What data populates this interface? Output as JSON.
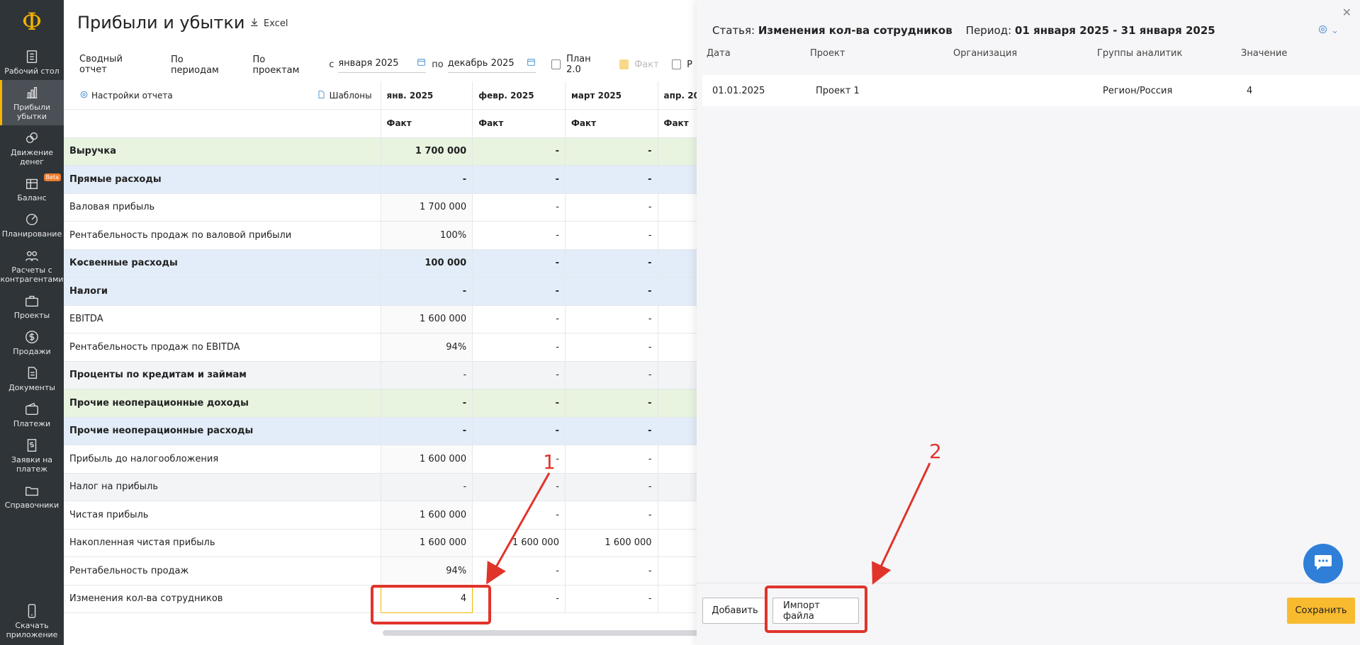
{
  "sidebar": {
    "logo": "Ф",
    "items": [
      {
        "label": "Рабочий стол",
        "icon": "dashboard-icon"
      },
      {
        "label": "Прибыли убытки",
        "icon": "bar-chart-icon",
        "active": true
      },
      {
        "label": "Движение денег",
        "icon": "money-flow-icon"
      },
      {
        "label": "Баланс",
        "icon": "balance-icon",
        "badge": "Beta"
      },
      {
        "label": "Планирование",
        "icon": "planning-icon"
      },
      {
        "label": "Расчеты с контрагентами",
        "icon": "counterparties-icon"
      },
      {
        "label": "Проекты",
        "icon": "briefcase-icon"
      },
      {
        "label": "Продажи",
        "icon": "dollar-icon"
      },
      {
        "label": "Документы",
        "icon": "documents-icon"
      },
      {
        "label": "Платежи",
        "icon": "wallet-icon"
      },
      {
        "label": "Заявки на платеж",
        "icon": "payment-request-icon"
      },
      {
        "label": "Справочники",
        "icon": "folder-icon"
      }
    ],
    "download": "Скачать приложение"
  },
  "header": {
    "title": "Прибыли и убытки",
    "excel": "Excel"
  },
  "toolbar": {
    "tabs": [
      "Сводный отчет",
      "По периодам",
      "По проектам"
    ],
    "from_label": "с",
    "from_value": "января 2025",
    "to_label": "по",
    "to_value": "декабрь 2025",
    "plan_label": "План 2.0",
    "fact_label": "Факт",
    "extra_label": "Р"
  },
  "report": {
    "settings_label": "Настройки отчета",
    "templates_label": "Шаблоны",
    "months": [
      "янв. 2025",
      "февр. 2025",
      "март 2025",
      "апр. 20"
    ],
    "sub": [
      "Факт",
      "Факт",
      "Факт",
      "Факт"
    ],
    "rows": [
      {
        "name": "Выручка",
        "v": [
          "1 700 000",
          "-",
          "-"
        ],
        "style": "green",
        "expand": true
      },
      {
        "name": "Прямые расходы",
        "v": [
          "-",
          "-",
          "-"
        ],
        "style": "blue",
        "expand": true
      },
      {
        "name": "Валовая прибыль",
        "v": [
          "1 700 000",
          "-",
          "-"
        ],
        "style": "plain"
      },
      {
        "name": "Рентабельность продаж по валовой прибыли",
        "v": [
          "100%",
          "-",
          "-"
        ],
        "style": "plain"
      },
      {
        "name": "Косвенные расходы",
        "v": [
          "100 000",
          "-",
          "-"
        ],
        "style": "blue",
        "expand": true
      },
      {
        "name": "Налоги",
        "v": [
          "-",
          "-",
          "-"
        ],
        "style": "blue",
        "expand": true
      },
      {
        "name": "EBITDA",
        "v": [
          "1 600 000",
          "-",
          "-"
        ],
        "style": "plain"
      },
      {
        "name": "Рентабельность продаж по EBITDA",
        "v": [
          "94%",
          "-",
          "-"
        ],
        "style": "plain"
      },
      {
        "name": "Проценты по кредитам и займам",
        "v": [
          "-",
          "-",
          "-"
        ],
        "style": "grey"
      },
      {
        "name": "Прочие неоперационные доходы",
        "v": [
          "-",
          "-",
          "-"
        ],
        "style": "green",
        "expand": true
      },
      {
        "name": "Прочие неоперационные расходы",
        "v": [
          "-",
          "-",
          "-"
        ],
        "style": "blue",
        "expand": true
      },
      {
        "name": "Прибыль до налогообложения",
        "v": [
          "1 600 000",
          "-",
          "-"
        ],
        "style": "plain"
      },
      {
        "name": "Налог на прибыль",
        "v": [
          "-",
          "-",
          "-"
        ],
        "style": "greyplain"
      },
      {
        "name": "Чистая прибыль",
        "v": [
          "1 600 000",
          "-",
          "-"
        ],
        "style": "plain"
      },
      {
        "name": "Накопленная чистая прибыль",
        "v": [
          "1 600 000",
          "1 600 000",
          "1 600 000"
        ],
        "style": "plain"
      },
      {
        "name": "Рентабельность продаж",
        "v": [
          "94%",
          "-",
          "-"
        ],
        "style": "plain"
      },
      {
        "name": "Изменения кол-ва сотрудников",
        "v": [
          "4",
          "-",
          "-"
        ],
        "style": "plain",
        "highlight": true
      }
    ]
  },
  "annotations": {
    "one": "1",
    "two": "2",
    "color": "#e0342b"
  },
  "panel": {
    "article_label": "Статья:",
    "article_value": "Изменения кол-ва сотрудников",
    "period_label": "Период:",
    "period_value": "01 января 2025 - 31 января 2025",
    "columns": [
      "Дата",
      "Проект",
      "Организация",
      "Группы аналитик",
      "Значение"
    ],
    "row": {
      "date": "01.01.2025",
      "project": "Проект 1",
      "org": "",
      "group": "Регион/Россия",
      "value": "4"
    },
    "add_button": "Добавить",
    "import_button": "Импорт файла",
    "save_button": "Сохранить"
  },
  "colors": {
    "accent": "#f4b400",
    "sidebar": "#2f3438",
    "chat": "#2f7fd8"
  }
}
